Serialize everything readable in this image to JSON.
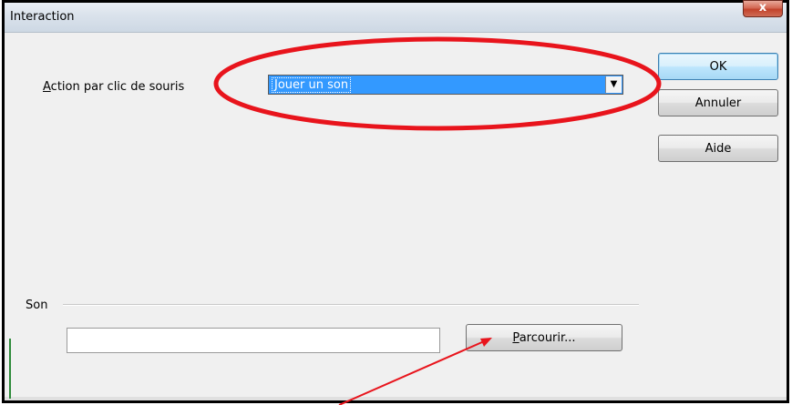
{
  "window": {
    "title": "Interaction",
    "close_glyph": "x"
  },
  "action": {
    "label_accesskey": "A",
    "label_rest": "ction par clic de souris",
    "selected_value": "Jouer un son"
  },
  "buttons": {
    "ok": "OK",
    "cancel": "Annuler",
    "help": "Aide",
    "browse_accesskey": "P",
    "browse_rest": "arcourir..."
  },
  "sound": {
    "group_label": "Son",
    "path_value": ""
  },
  "icons": {
    "close": "close-icon",
    "dropdown": "chevron-down-icon"
  },
  "colors": {
    "annotation": "#e8141c",
    "selection": "#3399ff"
  }
}
